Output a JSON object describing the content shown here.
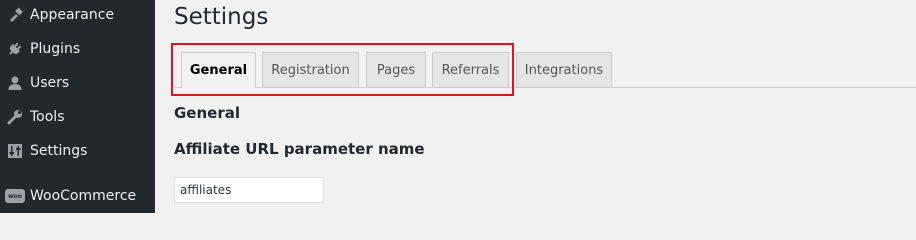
{
  "sidebar": {
    "items": [
      {
        "label": "Appearance",
        "icon": "paintbrush-icon"
      },
      {
        "label": "Plugins",
        "icon": "plug-icon"
      },
      {
        "label": "Users",
        "icon": "user-icon"
      },
      {
        "label": "Tools",
        "icon": "wrench-icon"
      },
      {
        "label": "Settings",
        "icon": "sliders-icon"
      },
      {
        "label": "WooCommerce",
        "icon": "woocommerce-icon",
        "icon_text": "woo"
      }
    ]
  },
  "main": {
    "title": "Settings",
    "tabs": [
      {
        "label": "General",
        "active": true
      },
      {
        "label": "Registration",
        "active": false
      },
      {
        "label": "Pages",
        "active": false
      },
      {
        "label": "Referrals",
        "active": false
      },
      {
        "label": "Integrations",
        "active": false
      }
    ],
    "section_heading": "General",
    "field_label": "Affiliate URL parameter name",
    "field_value": "affiliates"
  },
  "colors": {
    "sidebar_bg": "#23282d",
    "page_bg": "#f1f1f1",
    "highlight_border": "#e0141e"
  }
}
